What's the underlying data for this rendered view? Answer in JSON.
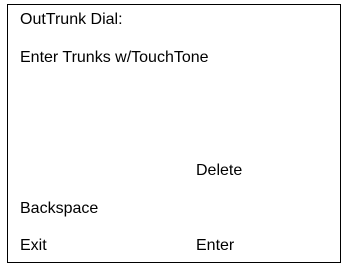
{
  "display": {
    "title": "OutTrunk Dial:",
    "prompt": "Enter Trunks w/TouchTone"
  },
  "softkeys": {
    "delete": "Delete",
    "backspace": "Backspace",
    "exit": "Exit",
    "enter": "Enter"
  }
}
